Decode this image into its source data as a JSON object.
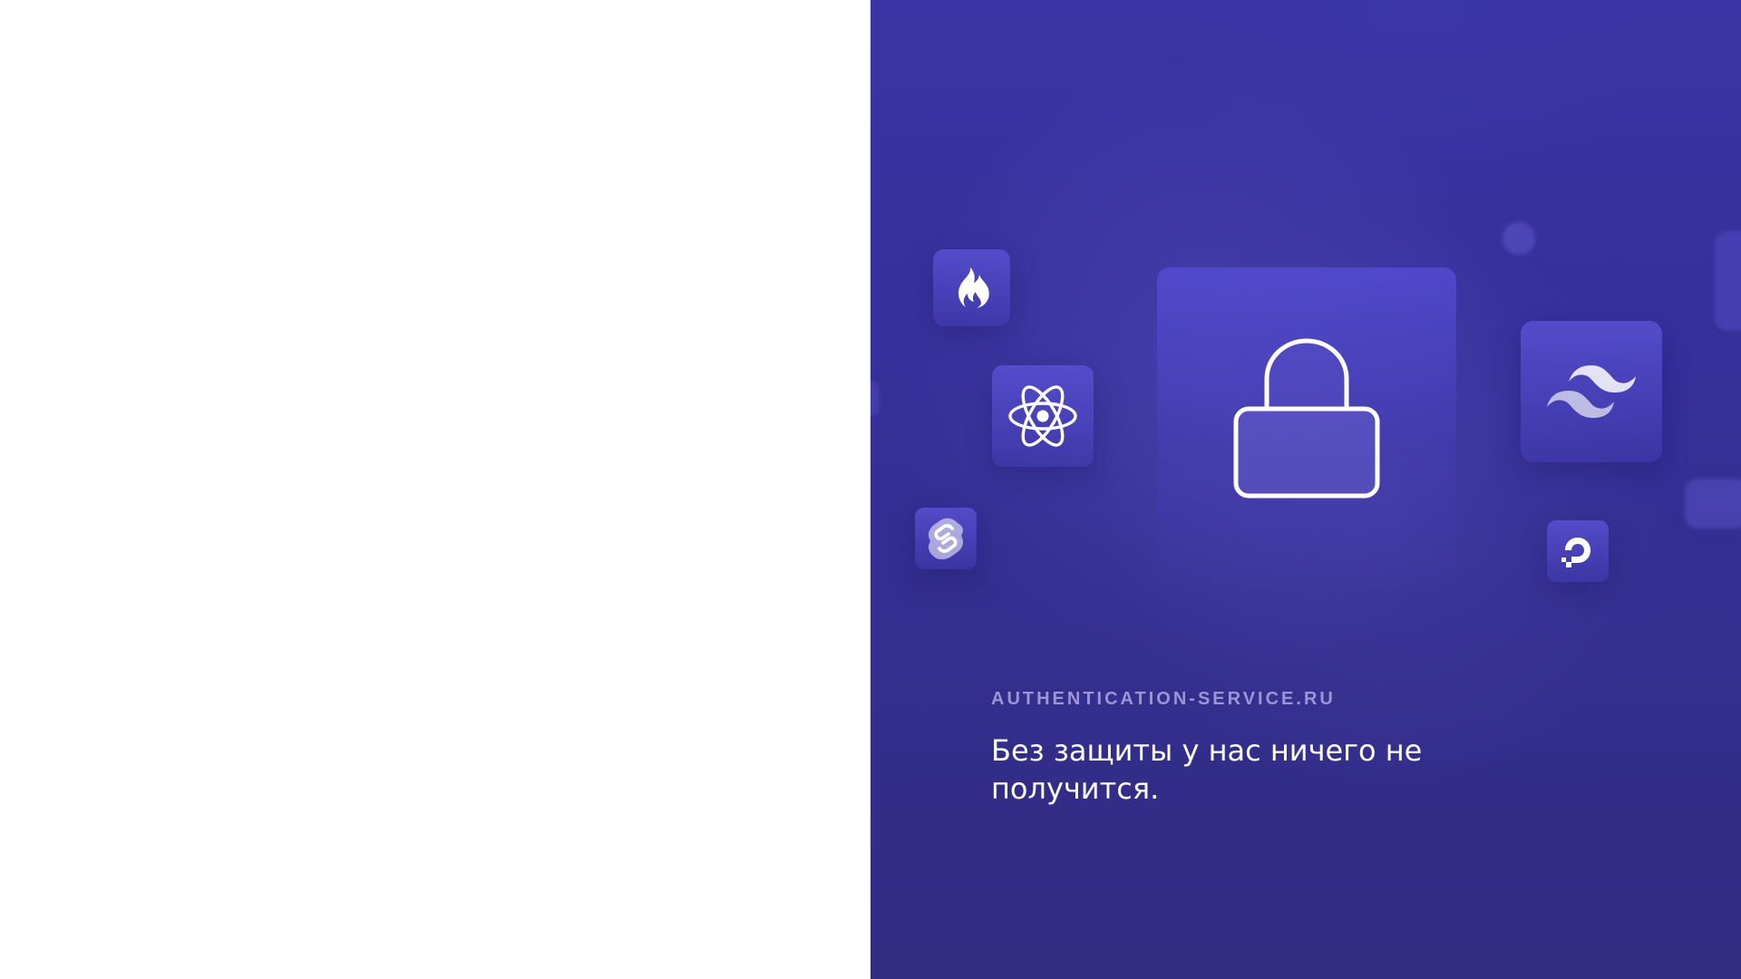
{
  "hero": {
    "domain": "AUTHENTICATION-SERVICE.RU",
    "tagline": "Без защиты у нас ничего не получится."
  },
  "icons": [
    {
      "name": "codeigniter-flame-icon"
    },
    {
      "name": "react-atom-icon"
    },
    {
      "name": "svelte-icon"
    },
    {
      "name": "lock-icon"
    },
    {
      "name": "tailwind-icon"
    },
    {
      "name": "digitalocean-icon"
    }
  ],
  "colors": {
    "panel_top": "#3a34a6",
    "panel_bottom": "#322c82",
    "domain_text": "#9b97d6",
    "tagline_text": "#ffffff"
  }
}
